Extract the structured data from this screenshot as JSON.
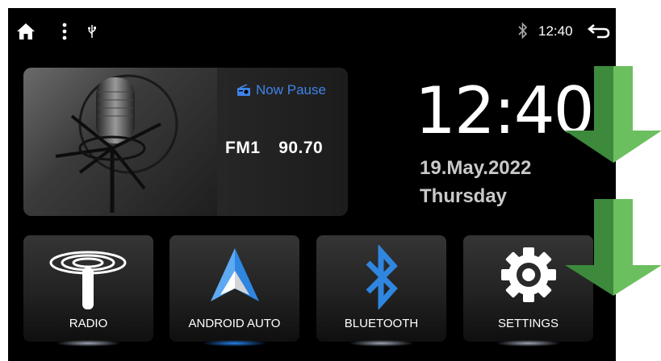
{
  "statusbar": {
    "icons": [
      "home-icon",
      "more-vert-icon",
      "usb-icon",
      "bluetooth-icon",
      "back-icon"
    ],
    "time": "12:40"
  },
  "radio_card": {
    "status": "Now Pause",
    "band": "FM1",
    "frequency": "90.70",
    "icon": "radio-icon"
  },
  "clock": {
    "time": "12:40",
    "date": "19.May.2022",
    "weekday": "Thursday"
  },
  "apps": [
    {
      "label": "RADIO",
      "icon": "antenna-icon"
    },
    {
      "label": "ANDROID AUTO",
      "icon": "android-auto-icon"
    },
    {
      "label": "BLUETOOTH",
      "icon": "bluetooth-icon"
    },
    {
      "label": "SETTINGS",
      "icon": "gear-icon"
    }
  ],
  "colors": {
    "accent_blue": "#3f83e8",
    "arrow_green_light": "#6cbf5f",
    "arrow_green_dark": "#3d8a3c"
  }
}
